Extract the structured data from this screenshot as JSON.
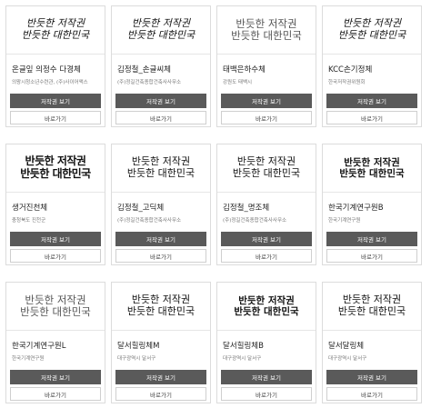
{
  "buttons": {
    "view_label": "저작권 보기",
    "go_label": "바로가기"
  },
  "cards": [
    {
      "preview_lines": [
        "반듯한 저작권",
        "반듯한 대한민국"
      ],
      "style": "hand",
      "name": "온글잎 의정수 다경체",
      "org": "의왕시청소년수련관, (주)사이어액스"
    },
    {
      "preview_lines": [
        "반듯한 저작권",
        "반듯한 대한민국"
      ],
      "style": "hand",
      "name": "김정철_손글씨체",
      "org": "(주)정길건축종합건축사사무소"
    },
    {
      "preview_lines": [
        "반듯한 저작권",
        "반듯한 대한민국"
      ],
      "style": "light",
      "name": "태백은하수체",
      "org": "강원도 태백시"
    },
    {
      "preview_lines": [
        "반듯한 저작권",
        "반듯한 대한민국"
      ],
      "style": "hand",
      "name": "KCC손기정체",
      "org": "한국저작권위원회"
    },
    {
      "preview_lines": [
        "반듯한 저작권",
        "반듯한 대한민국"
      ],
      "style": "brush",
      "name": "생거진천체",
      "org": "충청북도 진천군"
    },
    {
      "preview_lines": [
        "반듯한 저작권",
        "반듯한 대한민국"
      ],
      "style": "normal",
      "name": "김정철_고딕체",
      "org": "(주)정길건축종합건축사사무소"
    },
    {
      "preview_lines": [
        "반듯한 저작권",
        "반듯한 대한민국"
      ],
      "style": "normal",
      "name": "김정철_명조체",
      "org": "(주)정길건축종합건축사사무소"
    },
    {
      "preview_lines": [
        "반듯한 저작권",
        "반듯한 대한민국"
      ],
      "style": "bold",
      "name": "한국기계연구원B",
      "org": "한국기계연구원"
    },
    {
      "preview_lines": [
        "반듯한 저작권",
        "반듯한 대한민국"
      ],
      "style": "light",
      "name": "한국기계연구원L",
      "org": "한국기계연구원"
    },
    {
      "preview_lines": [
        "반듯한 저작권",
        "반듯한 대한민국"
      ],
      "style": "normal",
      "name": "달서힐링체M",
      "org": "대구광역시 달서구"
    },
    {
      "preview_lines": [
        "반듯한 저작권",
        "반듯한 대한민국"
      ],
      "style": "bold",
      "name": "달서힐링체B",
      "org": "대구광역시 달서구"
    },
    {
      "preview_lines": [
        "반듯한 저작권",
        "반듯한 대한민국"
      ],
      "style": "normal",
      "name": "달서달링체",
      "org": "대구광역시 달서구"
    }
  ]
}
